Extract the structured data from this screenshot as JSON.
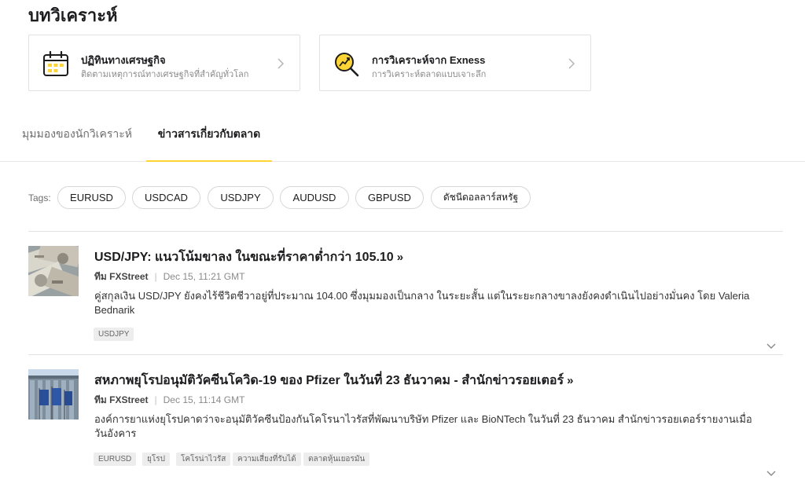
{
  "page": {
    "title": "บทวิเคราะห์"
  },
  "cards": [
    {
      "title": "ปฏิทินทางเศรษฐกิจ",
      "subtitle": "ติดตามเหตุการณ์ทางเศรษฐกิจที่สำคัญทั่วโลก",
      "icon": "calendar-icon"
    },
    {
      "title": "การวิเคราะห์จาก Exness",
      "subtitle": "การวิเคราะห์ตลาดแบบเจาะลึก",
      "icon": "analysis-magnifier-icon"
    }
  ],
  "tabs": [
    {
      "label": "มุมมองของนักวิเคราะห์",
      "active": false
    },
    {
      "label": "ข่าวสารเกี่ยวกับตลาด",
      "active": true
    }
  ],
  "tags": {
    "label": "Tags:",
    "items": [
      "EURUSD",
      "USDCAD",
      "USDJPY",
      "AUDUSD",
      "GBPUSD",
      "ดัชนีดอลลาร์สหรัฐ"
    ]
  },
  "articles": [
    {
      "title": "USD/JPY: แนวโน้มขาลง ในขณะที่ราคาต่ำกว่า 105.10",
      "arrow": "»",
      "author": "ทีม FXStreet",
      "separator": "|",
      "date": "Dec 15, 11:21 GMT",
      "excerpt": "คู่สกุลเงิน USD/JPY ยังคงไร้ชีวิตชีวาอยู่ที่ประมาณ 104.00 ซึ่งมุมมองเป็นกลาง ในระยะสั้น แต่ในระยะกลางขาลงยังคงดำเนินไปอย่างมั่นคง โดย Valeria Bednarik",
      "tags": [
        "USDJPY"
      ]
    },
    {
      "title": "สหภาพยุโรปอนุมัติวัคซีนโควิด-19 ของ Pfizer ในวันที่ 23 ธันวาคม - สำนักข่าวรอยเตอร์",
      "arrow": "»",
      "author": "ทีม FXStreet",
      "separator": "|",
      "date": "Dec 15, 11:14 GMT",
      "excerpt": "องค์การยาแห่งยุโรปคาดว่าจะอนุมัติวัคซีนป้องกันโคโรนาไวรัสที่พัฒนาบริษัท Pfizer และ BioNTech ในวันที่ 23 ธันวาคม สำนักข่าวรอยเตอร์รายงานเมื่อวันอังคาร",
      "tags": [
        "EURUSD",
        "ยุโรป",
        "โคโรน่าไวรัส",
        "ความเสี่ยงที่รับได้",
        "ตลาดหุ้นเยอรมัน"
      ]
    }
  ],
  "colors": {
    "accent": "#ffd535",
    "text": "#1d1d1f",
    "muted": "#8a8a8a",
    "border": "#e2e2e2"
  }
}
